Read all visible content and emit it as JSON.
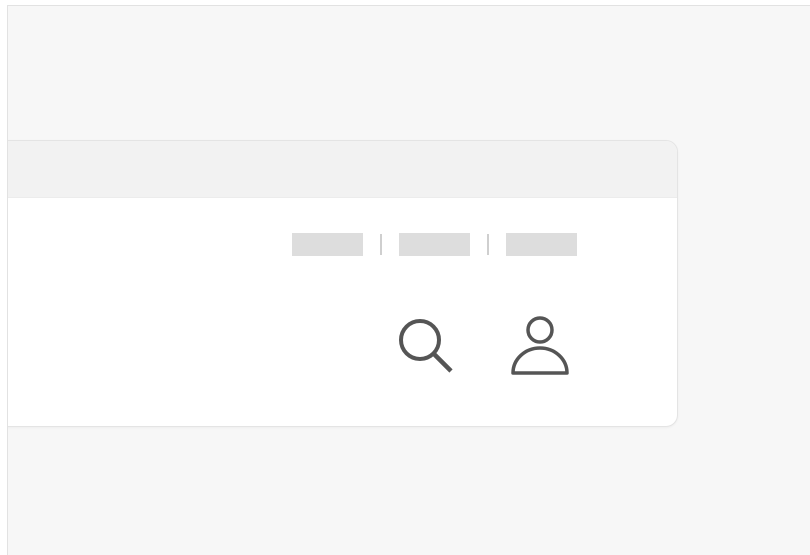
{
  "header": {
    "links": [
      {
        "label": ""
      },
      {
        "label": ""
      },
      {
        "label": ""
      }
    ]
  },
  "actions": {
    "search_icon": "search-icon",
    "user_icon": "user-icon"
  },
  "colors": {
    "background": "#f7f7f7",
    "card": "#ffffff",
    "card_header": "#f2f2f2",
    "placeholder": "#dddddd",
    "icon": "#555555"
  }
}
